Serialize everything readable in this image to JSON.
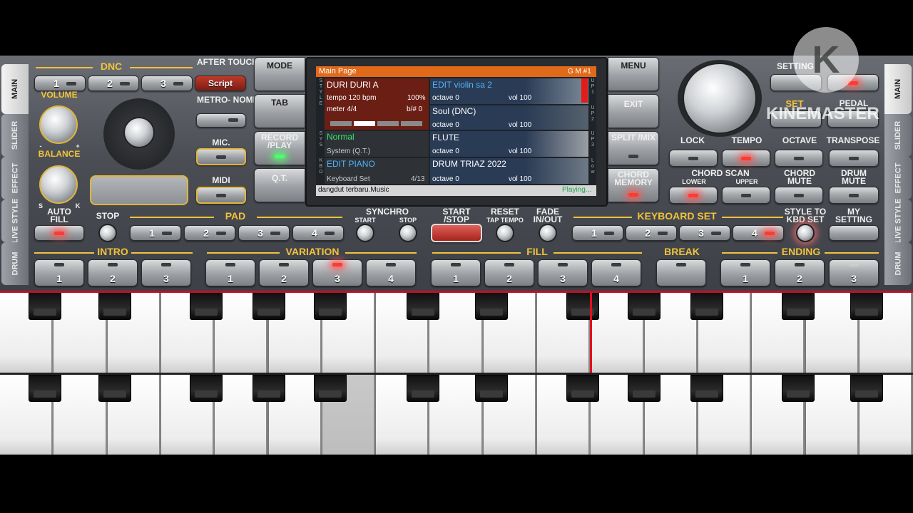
{
  "side_tabs_left": [
    "MAIN",
    "SLIDER",
    "EFFECT",
    "LIVE STYLE",
    "DRUM"
  ],
  "side_tabs_right": [
    "MAIN",
    "SLIDER",
    "EFFECT",
    "LIVE STYLE",
    "DRUM"
  ],
  "dnc": {
    "label": "DNC",
    "buttons": [
      "1",
      "2",
      "3"
    ],
    "script_label": "Script"
  },
  "after_touch_label": "AFTER TOUCH",
  "metronome_label": "METRO- NOME",
  "mic_label": "MIC.",
  "midi_label": "MIDI",
  "volume_label": "VOLUME",
  "volume_minus": "-",
  "volume_plus": "+",
  "balance_label": "BALANCE",
  "balance_s": "S",
  "balance_k": "K",
  "auto_fill_label": "AUTO FILL",
  "left_column": {
    "mode": "MODE",
    "tab": "TAB",
    "record_play": "RECORD /PLAY",
    "qt": "Q.T."
  },
  "right_column": {
    "menu": "MENU",
    "exit": "EXIT",
    "split_mix": "SPLIT /MIX",
    "chord_memory": "CHORD MEMORY"
  },
  "screen": {
    "header_left": "Main Page",
    "header_right": "G M #1",
    "side_labels": [
      "S T Y L E",
      "S Y S",
      "K B D"
    ],
    "right_labels": [
      "U P 1",
      "U P 2",
      "U P 3",
      "L o w"
    ],
    "style": {
      "name": "DURI DURI A",
      "tempo": "tempo 120 bpm",
      "percent": "100%",
      "meter": "meter 4/4",
      "bsharp": "b/# 0"
    },
    "sys": {
      "name": "Normal",
      "sub": "System (Q.T.)"
    },
    "kbd": {
      "name": "EDIT PIANO",
      "sub": "Keyboard Set",
      "count": "4/13"
    },
    "voices": [
      {
        "name": "EDIT violin sa 2",
        "octave": "octave 0",
        "vol": "vol 100"
      },
      {
        "name": "Soul (DNC)",
        "octave": "octave 0",
        "vol": "vol 100"
      },
      {
        "name": "FLUTE",
        "octave": "octave 0",
        "vol": "vol 100"
      },
      {
        "name": "DRUM TRIAZ 2022",
        "octave": "octave 0",
        "vol": "vol 100"
      }
    ],
    "status_left": "dangdut terbaru.Music",
    "status_right": "Playing..."
  },
  "setting_label": "SETTING",
  "set_label": "SET",
  "pedal_label": "PEDAL",
  "lock_label": "LOCK",
  "tempo_label": "TEMPO",
  "octave_label": "OCTAVE",
  "transpose_label": "TRANSPOSE",
  "chord_scan": {
    "label": "CHORD SCAN",
    "lower": "LOWER",
    "upper": "UPPER"
  },
  "chord_mute_label": "CHORD MUTE",
  "drum_mute_label": "DRUM MUTE",
  "stop_label": "STOP",
  "pad": {
    "label": "PAD",
    "buttons": [
      "1",
      "2",
      "3",
      "4"
    ]
  },
  "synchro": {
    "label": "SYNCHRO",
    "start": "START",
    "stop": "STOP"
  },
  "start_stop_label": "START /STOP",
  "reset_label": "RESET",
  "tap_tempo_label": "TAP TEMPO",
  "fade_label": "FADE IN/OUT",
  "keyboard_set": {
    "label": "KEYBOARD SET",
    "buttons": [
      "1",
      "2",
      "3",
      "4"
    ]
  },
  "style_to_kbd_label": "STYLE TO KBD SET",
  "my_setting_label": "MY SETTING",
  "intro": {
    "label": "INTRO",
    "buttons": [
      "1",
      "2",
      "3"
    ]
  },
  "variation": {
    "label": "VARIATION",
    "buttons": [
      "1",
      "2",
      "3",
      "4"
    ]
  },
  "fill": {
    "label": "FILL",
    "buttons": [
      "1",
      "2",
      "3",
      "4"
    ]
  },
  "break_label": "BREAK",
  "ending": {
    "label": "ENDING",
    "buttons": [
      "1",
      "2",
      "3"
    ]
  },
  "watermark": {
    "text": "KINEMASTER",
    "logo": "K"
  }
}
